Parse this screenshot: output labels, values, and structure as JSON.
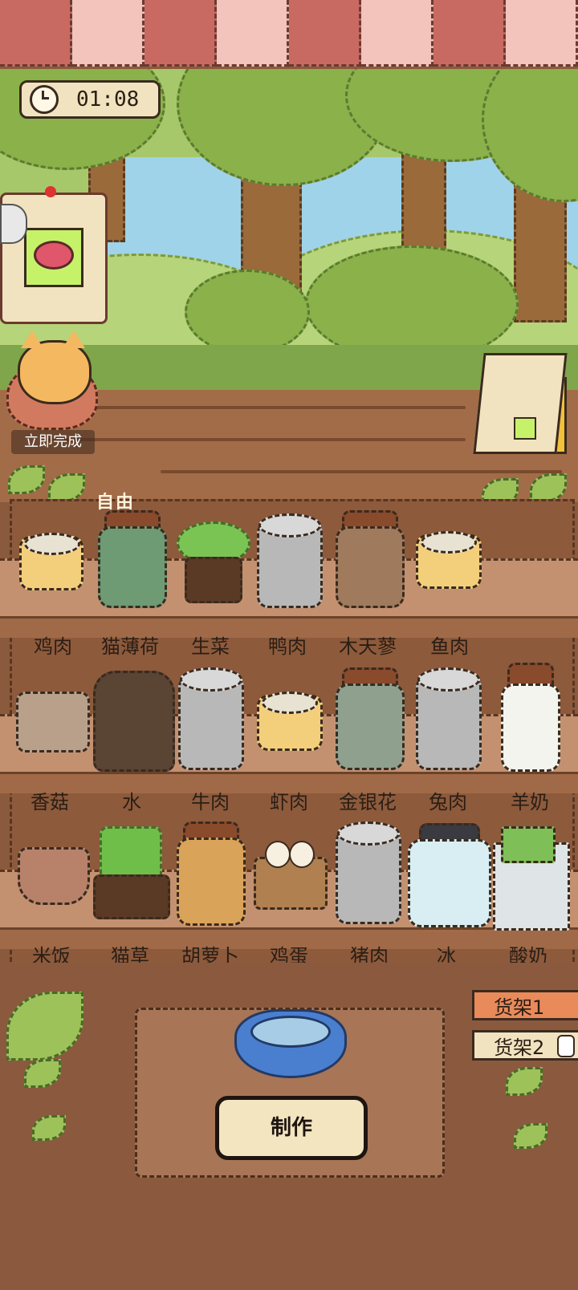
{
  "timer": {
    "text": "01:08"
  },
  "cat": {
    "complete_label": "立即完成"
  },
  "shelf_section_label": "自由",
  "shelves": [
    {
      "items": [
        {
          "label": "鸡肉",
          "kind": "tin"
        },
        {
          "label": "猫薄荷",
          "kind": "jar"
        },
        {
          "label": "生菜",
          "kind": "plant"
        },
        {
          "label": "鸭肉",
          "kind": "can"
        },
        {
          "label": "木天蓼",
          "kind": "jar"
        },
        {
          "label": "鱼肉",
          "kind": "tin"
        }
      ]
    },
    {
      "items": [
        {
          "label": "香菇",
          "kind": "basket"
        },
        {
          "label": "水",
          "kind": "barrel"
        },
        {
          "label": "牛肉",
          "kind": "can"
        },
        {
          "label": "虾肉",
          "kind": "tin"
        },
        {
          "label": "金银花",
          "kind": "jar"
        },
        {
          "label": "兔肉",
          "kind": "can"
        },
        {
          "label": "羊奶",
          "kind": "bottle"
        }
      ]
    },
    {
      "items": [
        {
          "label": "米饭",
          "kind": "bowl"
        },
        {
          "label": "猫草",
          "kind": "plant"
        },
        {
          "label": "胡萝卜",
          "kind": "jar"
        },
        {
          "label": "鸡蛋",
          "kind": "basket"
        },
        {
          "label": "猪肉",
          "kind": "can"
        },
        {
          "label": "冰",
          "kind": "jar"
        },
        {
          "label": "酸奶",
          "kind": "carton"
        }
      ]
    }
  ],
  "make_button": {
    "label": "制作"
  },
  "shelf_tabs": [
    {
      "label": "货架1",
      "active": true
    },
    {
      "label": "货架2",
      "active": false
    }
  ],
  "colors": {
    "awning_red": "#c96a62",
    "awning_pink": "#f2c4bb",
    "tab_active": "#e98a5a",
    "button_bg": "#f3e5c0"
  }
}
